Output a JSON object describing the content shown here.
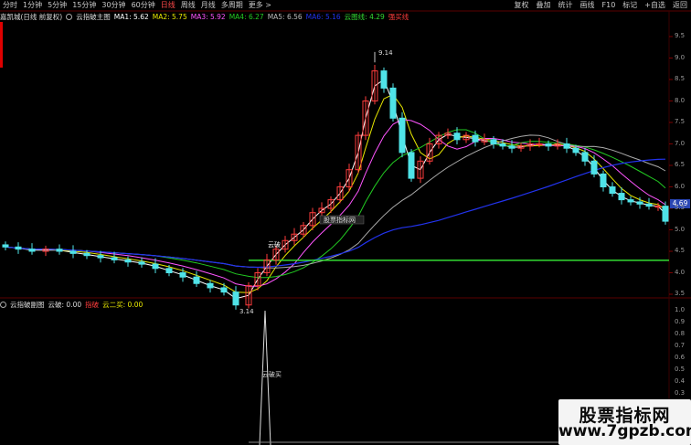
{
  "toolbar": {
    "timeframes": [
      "分时",
      "1分钟",
      "5分钟",
      "15分钟",
      "30分钟",
      "60分钟",
      "日线",
      "周线",
      "月线",
      "多周期",
      "更多 >"
    ],
    "active_timeframe": "日线",
    "tools": [
      "复权",
      "叠加",
      "统计",
      "画线",
      "F10",
      "标记",
      "+自选",
      "返回"
    ]
  },
  "main_info": {
    "stock": "嘉凯城(日线 前复权)",
    "indicator": "云指破主图",
    "ma1": "MA1: 5.62",
    "ma2": "MA2: 5.75",
    "ma3": "MA3: 5.92",
    "ma4": "MA4: 6.27",
    "ma5": "MA5: 6.56",
    "ma6": "MA6: 5.16",
    "cloud_line": "云图线: 4.29",
    "strong_line": "强买线"
  },
  "sub_info": {
    "indicator": "云指破副图",
    "cloud_break": "云破: 0.00",
    "cloud_break_word": "指破",
    "cloud_two_buy": "云二买: 0.00"
  },
  "price_axis": [
    "9.5",
    "9.0",
    "8.5",
    "8.0",
    "7.5",
    "7.0",
    "6.5",
    "6.0",
    "5.5",
    "5.0",
    "4.5",
    "4.0",
    "3.5"
  ],
  "sub_axis": [
    "1.0",
    "0.9",
    "0.8",
    "0.7",
    "0.6",
    "0.5",
    "0.4",
    "0.3",
    "0.2",
    "0.1"
  ],
  "current_price_tag": "4.69",
  "annotations": {
    "high": "9.14",
    "low": "3.14",
    "cloud_break_label": "云破",
    "website_label": "股票指标网",
    "sub_buy_label": "云破买"
  },
  "watermark": {
    "title": "股票指标网",
    "url": "www.7gpzb.com"
  },
  "colors": {
    "up": "#ff3c3c",
    "down": "#4fe3e8",
    "ma1": "#ffffff",
    "ma2": "#e8e800",
    "ma3": "#ff55ff",
    "ma4": "#22cc22",
    "ma5": "#aaaaaa",
    "ma6": "#2233ee",
    "cloud_line": "#33dd33",
    "price_tag": "#2a46b3"
  }
}
